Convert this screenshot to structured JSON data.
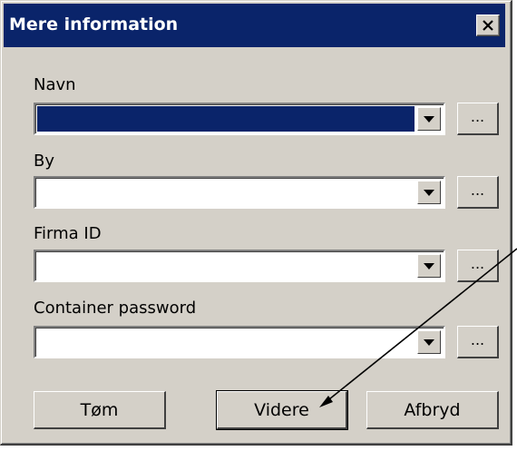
{
  "window": {
    "title": "Mere information",
    "close_symbol": "×"
  },
  "fields": [
    {
      "label": "Navn",
      "value": "",
      "selected": true
    },
    {
      "label": "By",
      "value": "",
      "selected": false
    },
    {
      "label": "Firma ID",
      "value": "",
      "selected": false
    },
    {
      "label": "Container password",
      "value": "",
      "selected": false
    }
  ],
  "dots_label": "...",
  "buttons": {
    "clear": "Tøm",
    "next": "Videre",
    "cancel": "Afbryd"
  },
  "icons": {
    "combo_arrow": "triangle-down-icon",
    "close": "close-icon",
    "annotation": "arrow-annotation-icon"
  },
  "colors": {
    "titlebar": "#0a246a",
    "face": "#d4d0c8",
    "selection": "#0a246a"
  }
}
